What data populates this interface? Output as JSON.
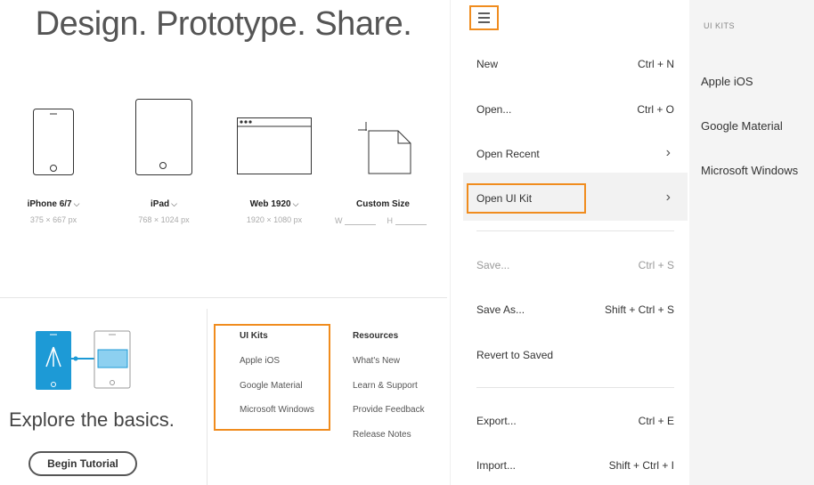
{
  "hero_title": "Design. Prototype. Share.",
  "presets": [
    {
      "label": "iPhone 6/7",
      "dims": "375 × 667 px"
    },
    {
      "label": "iPad",
      "dims": "768 × 1024 px"
    },
    {
      "label": "Web 1920",
      "dims": "1920 × 1080 px"
    },
    {
      "label": "Custom Size",
      "w_label": "W",
      "h_label": "H"
    }
  ],
  "explore": {
    "text": "Explore the basics.",
    "button": "Begin Tutorial"
  },
  "ui_kits_col": {
    "heading": "UI Kits",
    "items": [
      "Apple iOS",
      "Google Material",
      "Microsoft Windows"
    ]
  },
  "resources_col": {
    "heading": "Resources",
    "items": [
      "What's New",
      "Learn & Support",
      "Provide Feedback",
      "Release Notes"
    ]
  },
  "menu": {
    "items": [
      {
        "label": "New",
        "shortcut": "Ctrl + N"
      },
      {
        "label": "Open...",
        "shortcut": "Ctrl + O"
      },
      {
        "label": "Open Recent",
        "submenu_arrow": "›"
      },
      {
        "label": "Open UI Kit",
        "submenu_arrow": "›"
      },
      {
        "label": "Save...",
        "shortcut": "Ctrl + S",
        "disabled": true
      },
      {
        "label": "Save As...",
        "shortcut": "Shift + Ctrl + S"
      },
      {
        "label": "Revert to Saved"
      },
      {
        "label": "Export...",
        "shortcut": "Ctrl + E"
      },
      {
        "label": "Import...",
        "shortcut": "Shift + Ctrl + I"
      }
    ]
  },
  "submenu": {
    "heading": "UI KITS",
    "items": [
      "Apple iOS",
      "Google Material",
      "Microsoft Windows"
    ]
  },
  "colors": {
    "highlight_outline": "#f08c1e",
    "blue_accent": "#1d9ad6"
  },
  "icons": [
    "hamburger-icon",
    "iphone-icon",
    "ipad-icon",
    "web-icon",
    "custom-size-icon",
    "chevron-right-icon",
    "tutorial-illustration"
  ]
}
